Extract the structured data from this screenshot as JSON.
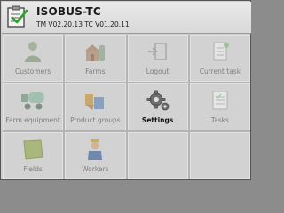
{
  "header": {
    "title": "ISOBUS-TC",
    "version": "TM V02.20.13 TC V01.20.11",
    "icon": "clipboard-check-icon"
  },
  "menu": [
    {
      "label": "Customers",
      "icon": "customers-icon"
    },
    {
      "label": "Farms",
      "icon": "farm-icon"
    },
    {
      "label": "Logout",
      "icon": "logout-icon"
    },
    {
      "label": "Current task",
      "icon": "current-task-icon"
    },
    {
      "label": "Farm equipment",
      "icon": "farm-equipment-icon"
    },
    {
      "label": "Product groups",
      "icon": "product-groups-icon"
    },
    {
      "label": "Settings",
      "icon": "gears-icon"
    },
    {
      "label": "Tasks",
      "icon": "tasks-icon"
    },
    {
      "label": "Fields",
      "icon": "field-icon"
    },
    {
      "label": "Workers",
      "icon": "worker-icon"
    }
  ],
  "colors": {
    "active_text": "#111111",
    "inactive_text": "#7d7d7d",
    "tile_bg": "#d2d2d2"
  }
}
